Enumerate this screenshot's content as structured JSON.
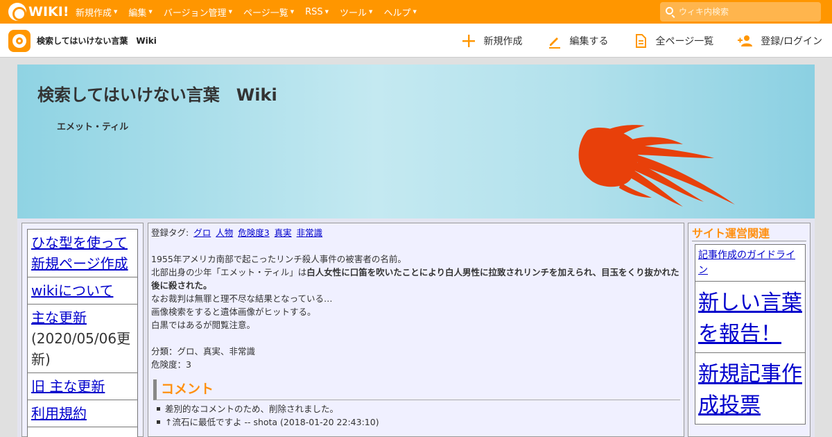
{
  "topbar": {
    "logo_text": "WIKI!",
    "nav": [
      {
        "label": "新規作成"
      },
      {
        "label": "編集"
      },
      {
        "label": "バージョン管理"
      },
      {
        "label": "ページ一覧"
      },
      {
        "label": "RSS"
      },
      {
        "label": "ツール"
      },
      {
        "label": "ヘルプ"
      }
    ],
    "search_placeholder": "ウィキ内検索"
  },
  "subbar": {
    "site_title": "検索してはいけない言葉　Wiki",
    "actions": [
      {
        "label": "新規作成",
        "icon": "plus-icon"
      },
      {
        "label": "編集する",
        "icon": "pencil-icon"
      },
      {
        "label": "全ページ一覧",
        "icon": "document-icon"
      },
      {
        "label": "登録/ログイン",
        "icon": "user-add-icon"
      }
    ]
  },
  "banner": {
    "title": "検索してはいけない言葉　Wiki",
    "page_name": "エメット・ティル"
  },
  "left_menu": {
    "items": [
      {
        "label": "ひな型を使って新規ページ作成",
        "link": true
      },
      {
        "label": "wikiについて",
        "link": true
      },
      {
        "label": "主な更新",
        "link": true,
        "note": "(2020/05/06更新)"
      },
      {
        "label": "旧 主な更新",
        "link": true
      },
      {
        "label": "利用規約",
        "link": true
      }
    ]
  },
  "main": {
    "tags_label": "登録タグ:",
    "tags": [
      "グロ",
      "人物",
      "危険度3",
      "真実",
      "非常識"
    ],
    "line1": "1955年アメリカ南部で起こったリンチ殺人事件の被害者の名前。",
    "line2_plain": "北部出身の少年「エメット・ティル」は",
    "line2_bold": "白人女性に口笛を吹いたことにより白人男性に拉致されリンチを加えられ、目玉をくり抜かれた後に殺された。",
    "line3": "なお裁判は無罪と理不尽な結果となっている…",
    "line4": "画像検索をすると遺体画像がヒットする。",
    "line5": "白黒ではあるが閲覧注意。",
    "category": "分類：グロ、真実、非常識",
    "danger": "危険度：3",
    "comment_heading": "コメント",
    "comments": [
      "差別的なコメントのため、削除されました。",
      "↑流石に最低ですよ -- shota (2018-01-20 22:43:10)"
    ]
  },
  "right_menu": {
    "title": "サイト運営関連",
    "items": [
      {
        "label": "記事作成のガイドライン",
        "size": "small"
      },
      {
        "label": "新しい言葉を報告！",
        "size": "big"
      },
      {
        "label": "新規記事作成投票",
        "size": "big"
      }
    ]
  },
  "colors": {
    "brand_orange": "#ff9600",
    "heading_orange": "#ff9010",
    "link_blue": "#0000cc",
    "fish_red": "#e8400a"
  }
}
